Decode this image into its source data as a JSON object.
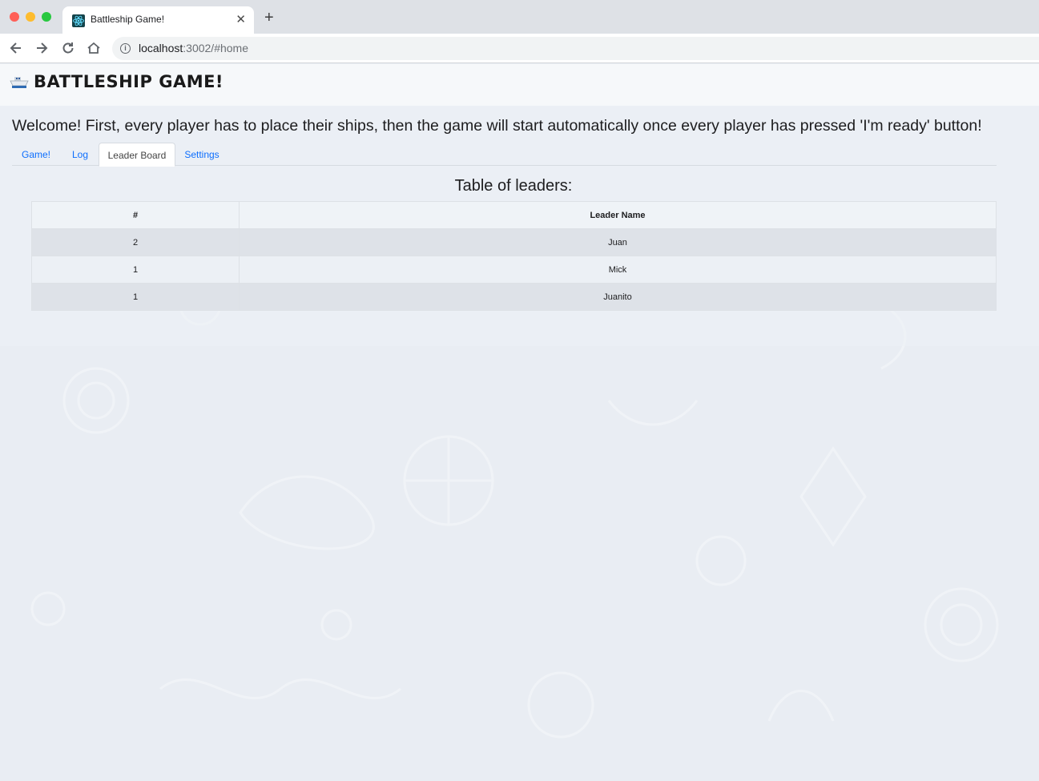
{
  "browser": {
    "tab_title": "Battleship Game!",
    "tab_close": "✕",
    "new_tab": "+",
    "url_host": "localhost",
    "url_rest": ":3002/#home"
  },
  "site": {
    "title": "BATTLESHIP GAME!",
    "welcome": "Welcome! First, every player has to place their ships, then the game will start automatically once every player has pressed 'I'm ready' button!"
  },
  "tabs": [
    {
      "label": "Game!",
      "active": false
    },
    {
      "label": "Log",
      "active": false
    },
    {
      "label": "Leader Board",
      "active": true
    },
    {
      "label": "Settings",
      "active": false
    }
  ],
  "leaderboard": {
    "title": "Table of leaders:",
    "columns": [
      "#",
      "Leader Name"
    ],
    "rows": [
      {
        "rank": "2",
        "name": "Juan"
      },
      {
        "rank": "1",
        "name": "Mick"
      },
      {
        "rank": "1",
        "name": "Juanito"
      }
    ]
  },
  "colors": {
    "link": "#0d6efd",
    "page_bg": "#e9edf3",
    "row_stripe": "#dee2e8"
  }
}
